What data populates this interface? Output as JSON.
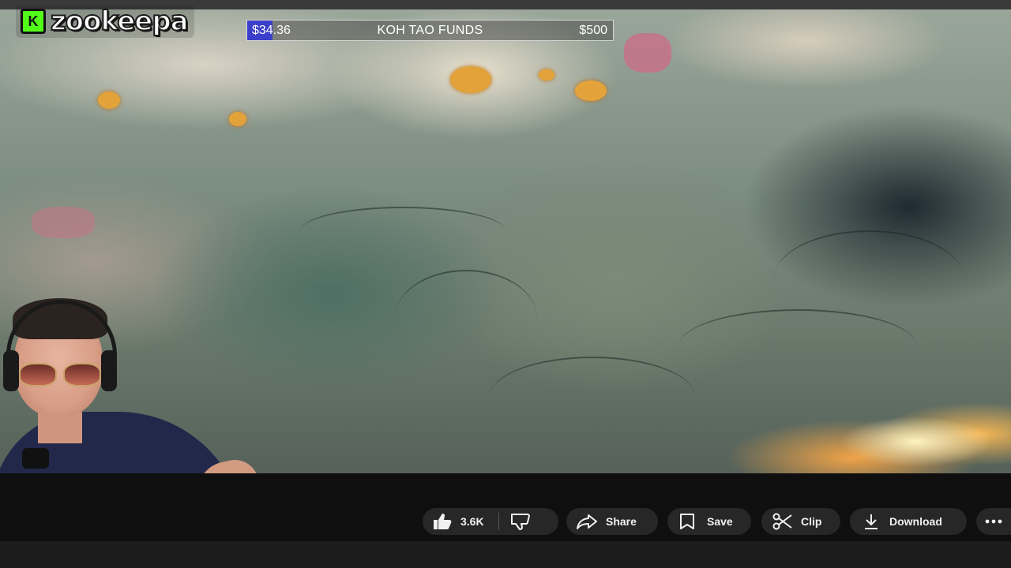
{
  "overlay": {
    "logo_badge": "K",
    "logo_text": "zookeepa",
    "funds": {
      "current": "$34.36",
      "title": "KOH TAO FUNDS",
      "goal": "$500",
      "progress_fraction": 0.0687,
      "bar_color": "#3b3fc9"
    }
  },
  "actions": {
    "like_count": "3.6K",
    "share_label": "Share",
    "save_label": "Save",
    "clip_label": "Clip",
    "download_label": "Download"
  },
  "icons": {
    "like": "thumbs-up-icon",
    "dislike": "thumbs-down-icon",
    "share": "share-arrow-icon",
    "save": "bookmark-icon",
    "clip": "scissors-icon",
    "download": "download-icon",
    "more": "more-dots-icon"
  }
}
